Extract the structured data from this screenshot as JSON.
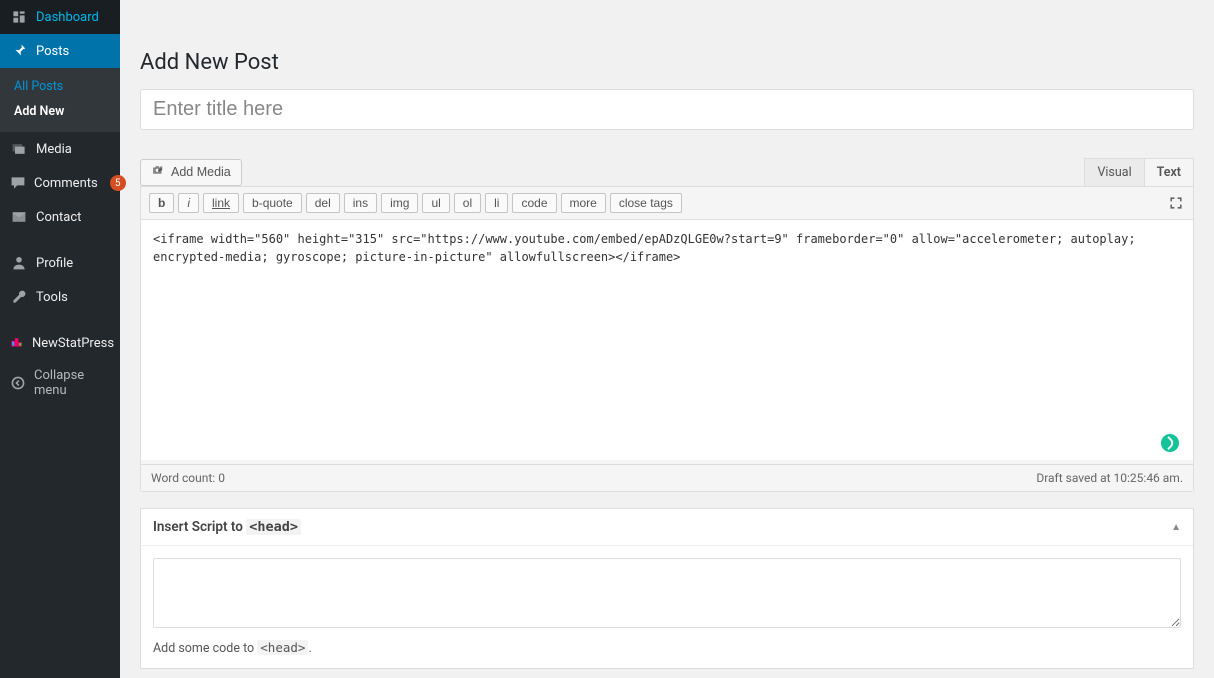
{
  "sidebar": {
    "items": [
      {
        "label": "Dashboard",
        "icon": "dashboard-icon"
      },
      {
        "label": "Posts",
        "icon": "pin-icon",
        "active": true,
        "submenu": [
          {
            "label": "All Posts",
            "link": true
          },
          {
            "label": "Add New",
            "current": true
          }
        ]
      },
      {
        "label": "Media",
        "icon": "media-icon"
      },
      {
        "label": "Comments",
        "icon": "comment-icon",
        "badge": "5"
      },
      {
        "label": "Contact",
        "icon": "mail-icon"
      },
      {
        "label": "Profile",
        "icon": "user-icon",
        "gapBefore": true
      },
      {
        "label": "Tools",
        "icon": "tools-icon"
      },
      {
        "label": "NewStatPress",
        "icon": "stats-icon",
        "gapBefore": true
      },
      {
        "label": "Collapse menu",
        "icon": "collapse-icon",
        "collapse": true
      }
    ]
  },
  "page": {
    "title": "Add New Post",
    "title_placeholder": "Enter title here"
  },
  "media_button": {
    "label": "Add Media"
  },
  "editor_tabs": {
    "visual": "Visual",
    "text": "Text"
  },
  "quicktags": [
    "b",
    "i",
    "link",
    "b-quote",
    "del",
    "ins",
    "img",
    "ul",
    "ol",
    "li",
    "code",
    "more",
    "close tags"
  ],
  "editor": {
    "content": "<iframe width=\"560\" height=\"315\" src=\"https://www.youtube.com/embed/epADzQLGE0w?start=9\" frameborder=\"0\" allow=\"accelerometer; autoplay; encrypted-media; gyroscope; picture-in-picture\" allowfullscreen></iframe>",
    "word_count_label": "Word count:",
    "word_count": "0",
    "autosave": "Draft saved at 10:25:46 am."
  },
  "metabox": {
    "title_prefix": "Insert Script to ",
    "title_code": "<head>",
    "note_prefix": "Add some code to ",
    "note_code": "<head>",
    "note_suffix": "."
  }
}
